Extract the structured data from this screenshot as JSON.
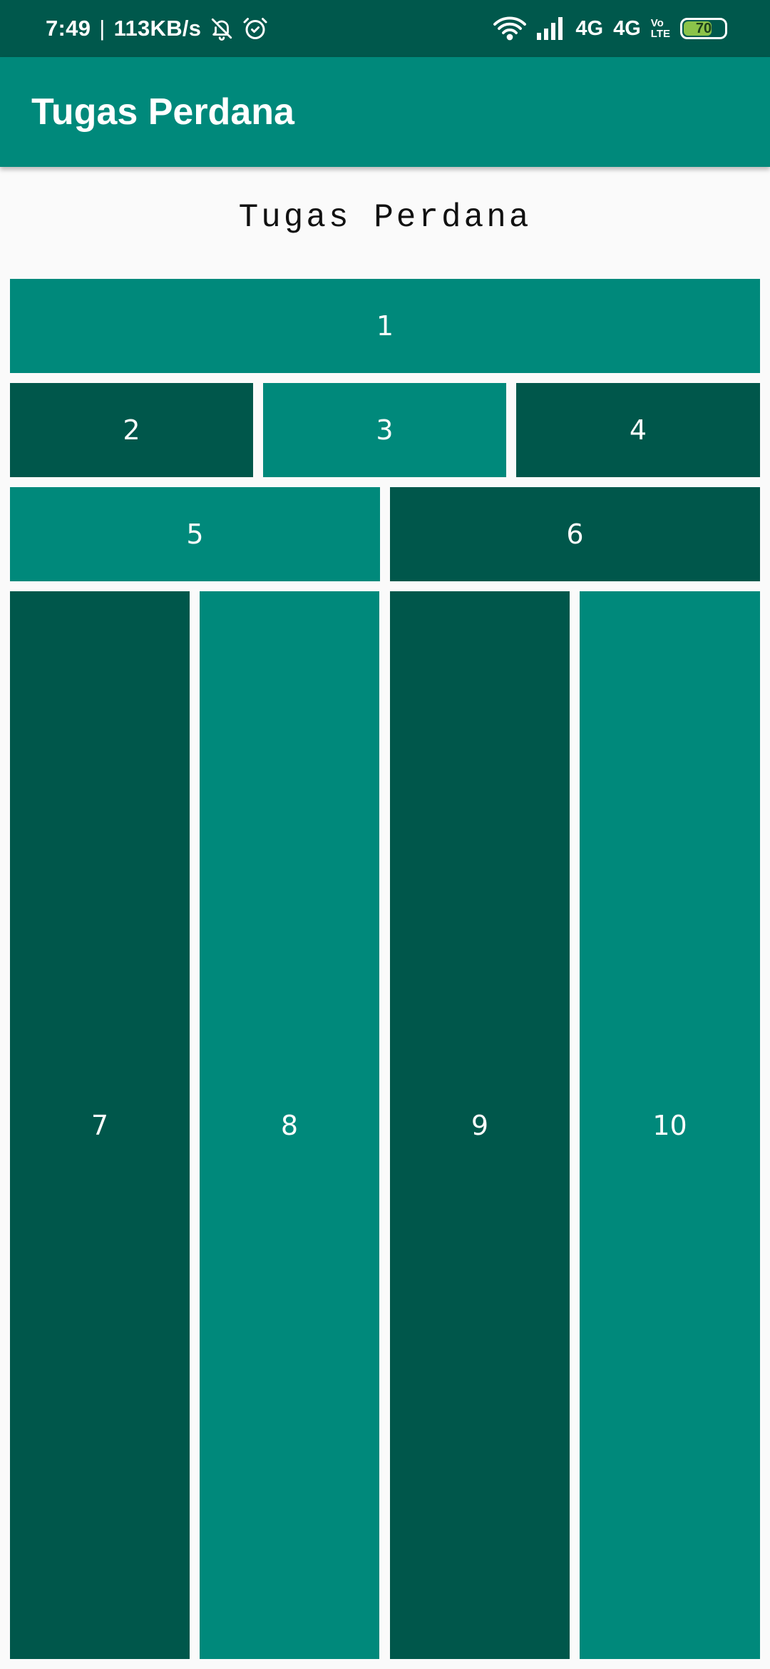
{
  "status_bar": {
    "time": "7:49",
    "separator": "|",
    "speed": "113KB/s",
    "icons": [
      "bell-off-icon",
      "alarm-icon",
      "wifi-icon",
      "signal-icon"
    ],
    "network1": "4G",
    "network2": "4G",
    "volte_top": "Vo",
    "volte_bottom": "LTE",
    "battery": "70",
    "battery_level": 0.7
  },
  "app_bar": {
    "title": "Tugas Perdana"
  },
  "page": {
    "heading": "Tugas Perdana"
  },
  "colors": {
    "status_bar": "#00584C",
    "primary": "#00897B",
    "primary_dark": "#00574B",
    "background": "#FAFAFA"
  },
  "boxes": [
    {
      "label": "1",
      "color": "#00897B"
    },
    {
      "label": "2",
      "color": "#00574B"
    },
    {
      "label": "3",
      "color": "#00897B"
    },
    {
      "label": "4",
      "color": "#00574B"
    },
    {
      "label": "5",
      "color": "#00897B"
    },
    {
      "label": "6",
      "color": "#00574B"
    },
    {
      "label": "7",
      "color": "#00574B"
    },
    {
      "label": "8",
      "color": "#00897B"
    },
    {
      "label": "9",
      "color": "#00574B"
    },
    {
      "label": "10",
      "color": "#00897B"
    }
  ]
}
